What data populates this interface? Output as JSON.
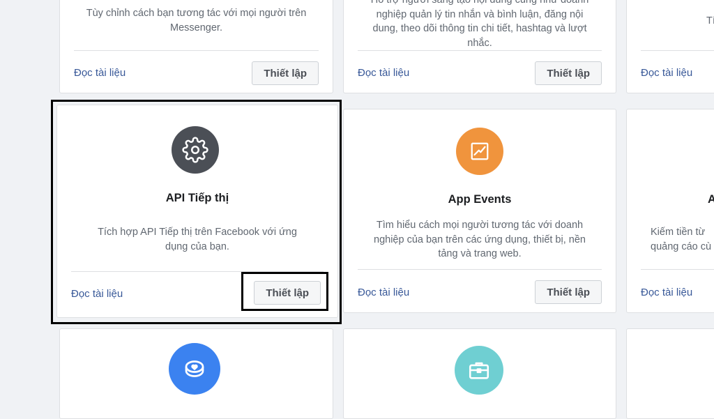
{
  "cards": {
    "messenger": {
      "description": "Tùy chỉnh cách bạn tương tác với mọi người trên Messenger.",
      "docs_label": "Đọc tài liệu",
      "setup_label": "Thiết lập"
    },
    "instagram": {
      "description_lines": [
        "Hỗ trợ người sáng tạo nội dung cũng như doanh",
        "nghiệp quản lý tin nhắn và bình luận, đăng nội",
        "dung, theo dõi thông tin chi tiết, hashtag và lượt",
        "nhắc."
      ],
      "docs_label": "Đọc tài liệu",
      "setup_label": "Thiết lập"
    },
    "right_top": {
      "description_fragment": "Tí",
      "docs_label": "Đọc tài liệu"
    },
    "marketing_api": {
      "icon": "gear-icon",
      "icon_color": "#4b4f56",
      "title": "API Tiếp thị",
      "description": "Tích hợp API Tiếp thị trên Facebook với ứng dụng của bạn.",
      "docs_label": "Đọc tài liệu",
      "setup_label": "Thiết lập"
    },
    "app_events": {
      "icon": "chart-icon",
      "icon_color": "#f0943d",
      "title": "App Events",
      "description": "Tìm hiểu cách mọi người tương tác với doanh nghiệp của bạn trên các ứng dụng, thiết bị, nền tảng và trang web.",
      "docs_label": "Đọc tài liệu",
      "setup_label": "Thiết lập"
    },
    "right_middle": {
      "title_fragment": "A",
      "description_fragment": "Kiếm tiền từ\nquảng cáo cù",
      "docs_label": "Đọc tài liệu"
    },
    "bottom_left": {
      "icon": "coin-heart-icon",
      "icon_color": "#3b82f0"
    },
    "bottom_middle": {
      "icon": "briefcase-icon",
      "icon_color": "#6fcfd2"
    }
  },
  "colors": {
    "highlight_border": "#000000",
    "link": "#385898"
  }
}
